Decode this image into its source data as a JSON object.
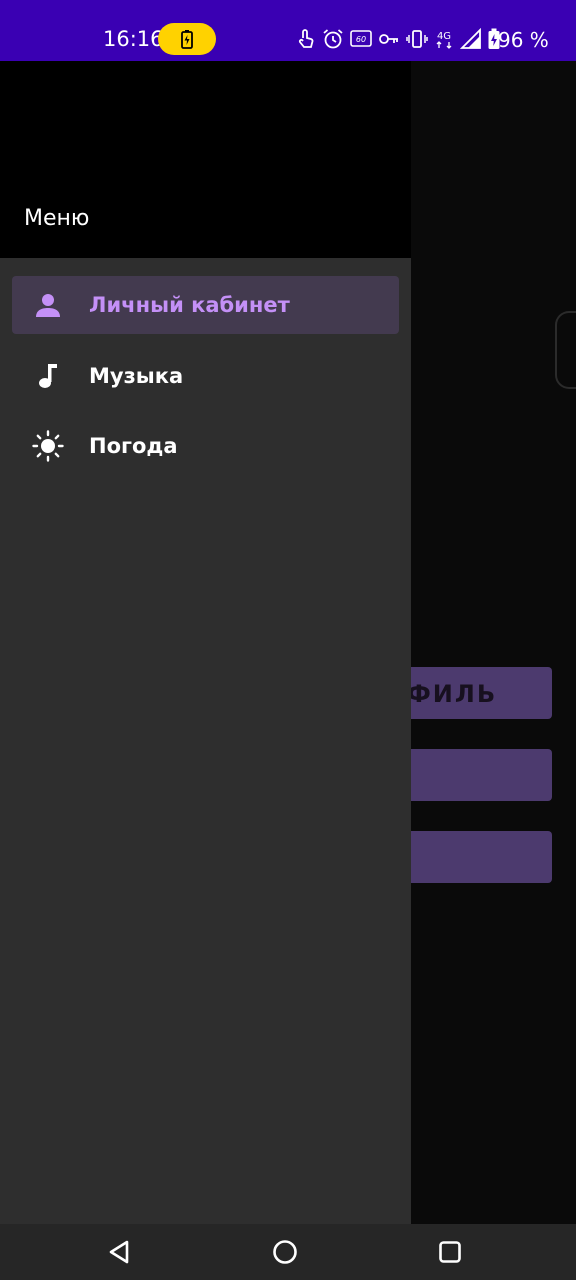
{
  "status_bar": {
    "time": "16:16",
    "battery_percent": "96 %",
    "charging_pill_color": "#ffd200",
    "icons": [
      "touch-icon",
      "alarm-icon",
      "refresh-rate-60-icon",
      "key-icon",
      "vibrate-icon",
      "network-4g-icon",
      "signal-icon",
      "battery-charging-icon"
    ],
    "network_label": "4G",
    "refresh_label": "60"
  },
  "drawer": {
    "title": "Меню",
    "items": [
      {
        "label": "Личный кабинет",
        "icon": "person-icon",
        "active": true
      },
      {
        "label": "Музыка",
        "icon": "music-note-icon",
        "active": false
      },
      {
        "label": "Погода",
        "icon": "sun-icon",
        "active": false
      }
    ],
    "accent_color": "#c490f7"
  },
  "background_screen": {
    "visible_button_text": "ФИЛЬ"
  },
  "nav_bar": {
    "buttons": [
      "back-icon",
      "home-icon",
      "recents-icon"
    ]
  }
}
